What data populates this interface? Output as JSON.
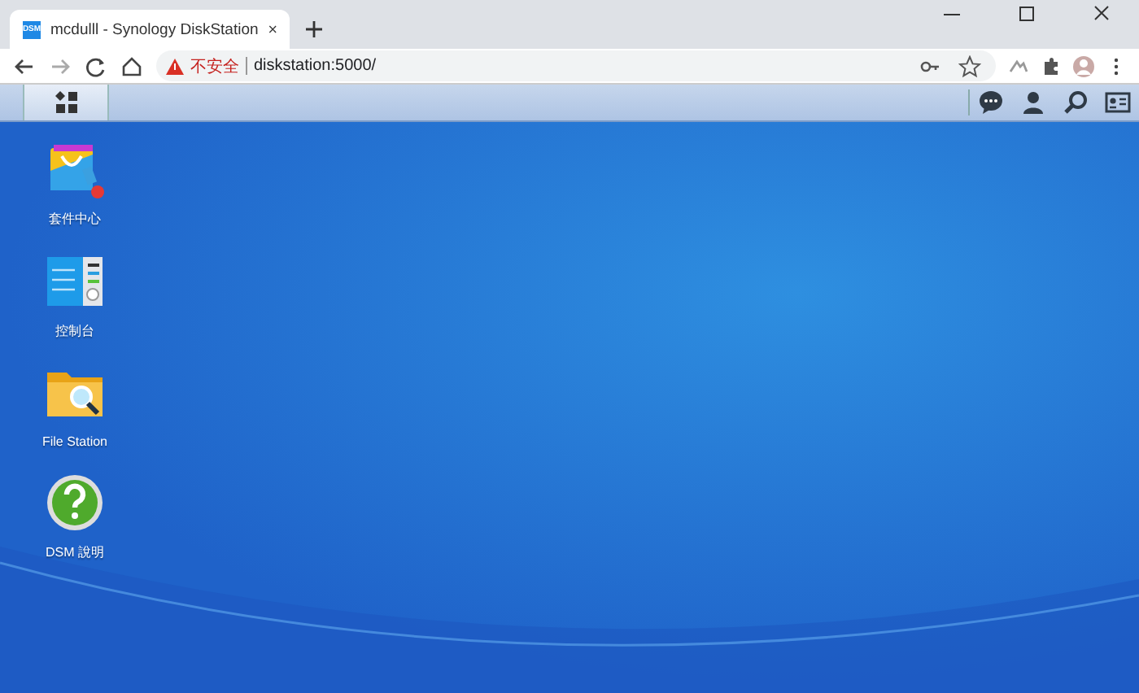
{
  "browser": {
    "tab": {
      "title": "mcdulll - Synology DiskStation",
      "favicon": "DSM"
    },
    "security_label": "不安全",
    "url": "diskstation:5000/"
  },
  "desktop": {
    "icons": [
      {
        "kind": "package",
        "label": "套件中心",
        "notification": true
      },
      {
        "kind": "control",
        "label": "控制台",
        "notification": false
      },
      {
        "kind": "folder",
        "label": "File Station",
        "notification": false
      },
      {
        "kind": "help",
        "label": "DSM 說明",
        "notification": false
      }
    ]
  }
}
